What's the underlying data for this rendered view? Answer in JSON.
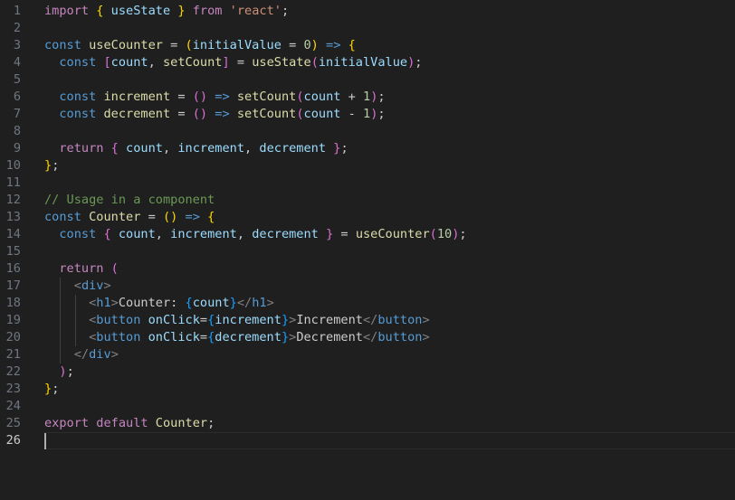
{
  "editor": {
    "theme": {
      "background": "#1f1f1f",
      "plain": "#cccccc",
      "keyword": "#c586c0",
      "storage": "#569cd6",
      "function": "#dcdcaa",
      "variable": "#9cdcfe",
      "string": "#ce9178",
      "number": "#b5cea8",
      "comment": "#6a9955",
      "tag": "#808080",
      "tagname": "#569cd6",
      "component": "#4ec9b0",
      "bracket1": "#ffd700",
      "bracket2": "#da70d6",
      "bracket3": "#179fff"
    },
    "lines": [
      {
        "n": "1",
        "tokens": [
          [
            "import",
            "keyword"
          ],
          [
            " ",
            "plain"
          ],
          [
            "{",
            "bracket1"
          ],
          [
            " ",
            "plain"
          ],
          [
            "useState",
            "variable"
          ],
          [
            " ",
            "plain"
          ],
          [
            "}",
            "bracket1"
          ],
          [
            " ",
            "plain"
          ],
          [
            "from",
            "keyword"
          ],
          [
            " ",
            "plain"
          ],
          [
            "'react'",
            "string"
          ],
          [
            ";",
            "plain"
          ]
        ]
      },
      {
        "n": "2",
        "tokens": []
      },
      {
        "n": "3",
        "tokens": [
          [
            "const",
            "storage"
          ],
          [
            " ",
            "plain"
          ],
          [
            "useCounter",
            "function"
          ],
          [
            " = ",
            "plain"
          ],
          [
            "(",
            "bracket1"
          ],
          [
            "initialValue",
            "variable"
          ],
          [
            " = ",
            "plain"
          ],
          [
            "0",
            "number"
          ],
          [
            ")",
            "bracket1"
          ],
          [
            " ",
            "plain"
          ],
          [
            "=>",
            "storage"
          ],
          [
            " ",
            "plain"
          ],
          [
            "{",
            "bracket1"
          ]
        ]
      },
      {
        "n": "4",
        "tokens": [
          [
            "  ",
            "plain"
          ],
          [
            "const",
            "storage"
          ],
          [
            " ",
            "plain"
          ],
          [
            "[",
            "bracket2"
          ],
          [
            "count",
            "variable"
          ],
          [
            ", ",
            "plain"
          ],
          [
            "setCount",
            "function"
          ],
          [
            "]",
            "bracket2"
          ],
          [
            " = ",
            "plain"
          ],
          [
            "useState",
            "function"
          ],
          [
            "(",
            "bracket2"
          ],
          [
            "initialValue",
            "variable"
          ],
          [
            ")",
            "bracket2"
          ],
          [
            ";",
            "plain"
          ]
        ]
      },
      {
        "n": "5",
        "tokens": []
      },
      {
        "n": "6",
        "tokens": [
          [
            "  ",
            "plain"
          ],
          [
            "const",
            "storage"
          ],
          [
            " ",
            "plain"
          ],
          [
            "increment",
            "function"
          ],
          [
            " = ",
            "plain"
          ],
          [
            "()",
            "bracket2"
          ],
          [
            " ",
            "plain"
          ],
          [
            "=>",
            "storage"
          ],
          [
            " ",
            "plain"
          ],
          [
            "setCount",
            "function"
          ],
          [
            "(",
            "bracket2"
          ],
          [
            "count",
            "variable"
          ],
          [
            " + ",
            "plain"
          ],
          [
            "1",
            "number"
          ],
          [
            ")",
            "bracket2"
          ],
          [
            ";",
            "plain"
          ]
        ]
      },
      {
        "n": "7",
        "tokens": [
          [
            "  ",
            "plain"
          ],
          [
            "const",
            "storage"
          ],
          [
            " ",
            "plain"
          ],
          [
            "decrement",
            "function"
          ],
          [
            " = ",
            "plain"
          ],
          [
            "()",
            "bracket2"
          ],
          [
            " ",
            "plain"
          ],
          [
            "=>",
            "storage"
          ],
          [
            " ",
            "plain"
          ],
          [
            "setCount",
            "function"
          ],
          [
            "(",
            "bracket2"
          ],
          [
            "count",
            "variable"
          ],
          [
            " - ",
            "plain"
          ],
          [
            "1",
            "number"
          ],
          [
            ")",
            "bracket2"
          ],
          [
            ";",
            "plain"
          ]
        ]
      },
      {
        "n": "8",
        "tokens": []
      },
      {
        "n": "9",
        "tokens": [
          [
            "  ",
            "plain"
          ],
          [
            "return",
            "keyword"
          ],
          [
            " ",
            "plain"
          ],
          [
            "{",
            "bracket2"
          ],
          [
            " ",
            "plain"
          ],
          [
            "count",
            "variable"
          ],
          [
            ", ",
            "plain"
          ],
          [
            "increment",
            "variable"
          ],
          [
            ", ",
            "plain"
          ],
          [
            "decrement",
            "variable"
          ],
          [
            " ",
            "plain"
          ],
          [
            "}",
            "bracket2"
          ],
          [
            ";",
            "plain"
          ]
        ]
      },
      {
        "n": "10",
        "tokens": [
          [
            "}",
            "bracket1"
          ],
          [
            ";",
            "plain"
          ]
        ]
      },
      {
        "n": "11",
        "tokens": []
      },
      {
        "n": "12",
        "tokens": [
          [
            "// Usage in a component",
            "comment"
          ]
        ]
      },
      {
        "n": "13",
        "tokens": [
          [
            "const",
            "storage"
          ],
          [
            " ",
            "plain"
          ],
          [
            "Counter",
            "function"
          ],
          [
            " = ",
            "plain"
          ],
          [
            "()",
            "bracket1"
          ],
          [
            " ",
            "plain"
          ],
          [
            "=>",
            "storage"
          ],
          [
            " ",
            "plain"
          ],
          [
            "{",
            "bracket1"
          ]
        ]
      },
      {
        "n": "14",
        "tokens": [
          [
            "  ",
            "plain"
          ],
          [
            "const",
            "storage"
          ],
          [
            " ",
            "plain"
          ],
          [
            "{",
            "bracket2"
          ],
          [
            " ",
            "plain"
          ],
          [
            "count",
            "variable"
          ],
          [
            ", ",
            "plain"
          ],
          [
            "increment",
            "variable"
          ],
          [
            ", ",
            "plain"
          ],
          [
            "decrement",
            "variable"
          ],
          [
            " ",
            "plain"
          ],
          [
            "}",
            "bracket2"
          ],
          [
            " = ",
            "plain"
          ],
          [
            "useCounter",
            "function"
          ],
          [
            "(",
            "bracket2"
          ],
          [
            "10",
            "number"
          ],
          [
            ")",
            "bracket2"
          ],
          [
            ";",
            "plain"
          ]
        ]
      },
      {
        "n": "15",
        "tokens": []
      },
      {
        "n": "16",
        "tokens": [
          [
            "  ",
            "plain"
          ],
          [
            "return",
            "keyword"
          ],
          [
            " ",
            "plain"
          ],
          [
            "(",
            "bracket2"
          ]
        ]
      },
      {
        "n": "17",
        "tokens": [
          [
            "    ",
            "plain"
          ],
          [
            "<",
            "tag"
          ],
          [
            "div",
            "tagname"
          ],
          [
            ">",
            "tag"
          ]
        ]
      },
      {
        "n": "18",
        "tokens": [
          [
            "      ",
            "plain"
          ],
          [
            "<",
            "tag"
          ],
          [
            "h1",
            "tagname"
          ],
          [
            ">",
            "tag"
          ],
          [
            "Counter: ",
            "plain"
          ],
          [
            "{",
            "bracket3"
          ],
          [
            "count",
            "variable"
          ],
          [
            "}",
            "bracket3"
          ],
          [
            "</",
            "tag"
          ],
          [
            "h1",
            "tagname"
          ],
          [
            ">",
            "tag"
          ]
        ]
      },
      {
        "n": "19",
        "tokens": [
          [
            "      ",
            "plain"
          ],
          [
            "<",
            "tag"
          ],
          [
            "button",
            "tagname"
          ],
          [
            " ",
            "plain"
          ],
          [
            "onClick",
            "variable"
          ],
          [
            "=",
            "plain"
          ],
          [
            "{",
            "bracket3"
          ],
          [
            "increment",
            "variable"
          ],
          [
            "}",
            "bracket3"
          ],
          [
            ">",
            "tag"
          ],
          [
            "Increment",
            "plain"
          ],
          [
            "</",
            "tag"
          ],
          [
            "button",
            "tagname"
          ],
          [
            ">",
            "tag"
          ]
        ]
      },
      {
        "n": "20",
        "tokens": [
          [
            "      ",
            "plain"
          ],
          [
            "<",
            "tag"
          ],
          [
            "button",
            "tagname"
          ],
          [
            " ",
            "plain"
          ],
          [
            "onClick",
            "variable"
          ],
          [
            "=",
            "plain"
          ],
          [
            "{",
            "bracket3"
          ],
          [
            "decrement",
            "variable"
          ],
          [
            "}",
            "bracket3"
          ],
          [
            ">",
            "tag"
          ],
          [
            "Decrement",
            "plain"
          ],
          [
            "</",
            "tag"
          ],
          [
            "button",
            "tagname"
          ],
          [
            ">",
            "tag"
          ]
        ]
      },
      {
        "n": "21",
        "tokens": [
          [
            "    ",
            "plain"
          ],
          [
            "</",
            "tag"
          ],
          [
            "div",
            "tagname"
          ],
          [
            ">",
            "tag"
          ]
        ]
      },
      {
        "n": "22",
        "tokens": [
          [
            "  ",
            "plain"
          ],
          [
            ")",
            "bracket2"
          ],
          [
            ";",
            "plain"
          ]
        ]
      },
      {
        "n": "23",
        "tokens": [
          [
            "}",
            "bracket1"
          ],
          [
            ";",
            "plain"
          ]
        ]
      },
      {
        "n": "24",
        "tokens": []
      },
      {
        "n": "25",
        "tokens": [
          [
            "export",
            "keyword"
          ],
          [
            " ",
            "plain"
          ],
          [
            "default",
            "keyword"
          ],
          [
            " ",
            "plain"
          ],
          [
            "Counter",
            "function"
          ],
          [
            ";",
            "plain"
          ]
        ]
      },
      {
        "n": "26",
        "tokens": [],
        "active": true
      }
    ]
  }
}
